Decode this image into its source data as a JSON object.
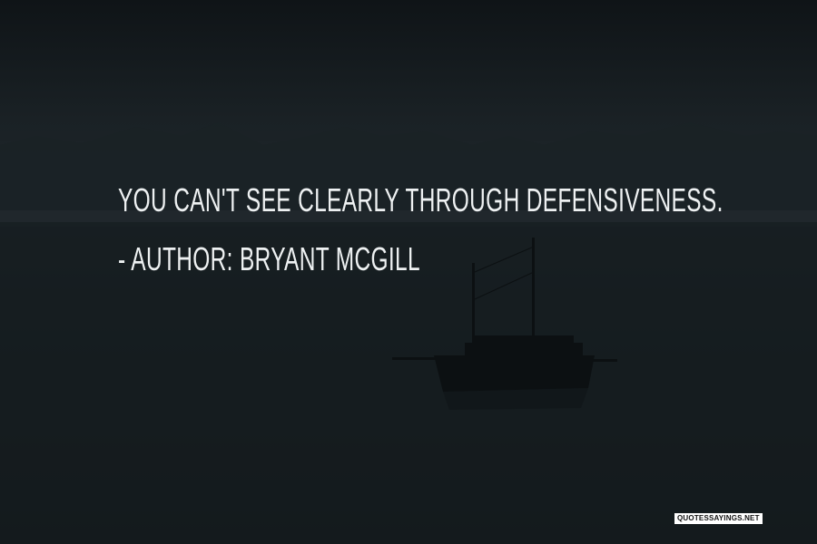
{
  "quote": {
    "text": "You can't see clearly through defensiveness.",
    "author_line": "- Author: Bryant McGill"
  },
  "watermark": {
    "text": "QUOTESSAYINGS.NET"
  },
  "colors": {
    "text": "#eef1f2",
    "sky": "#1e262a",
    "water": "#171e22"
  }
}
